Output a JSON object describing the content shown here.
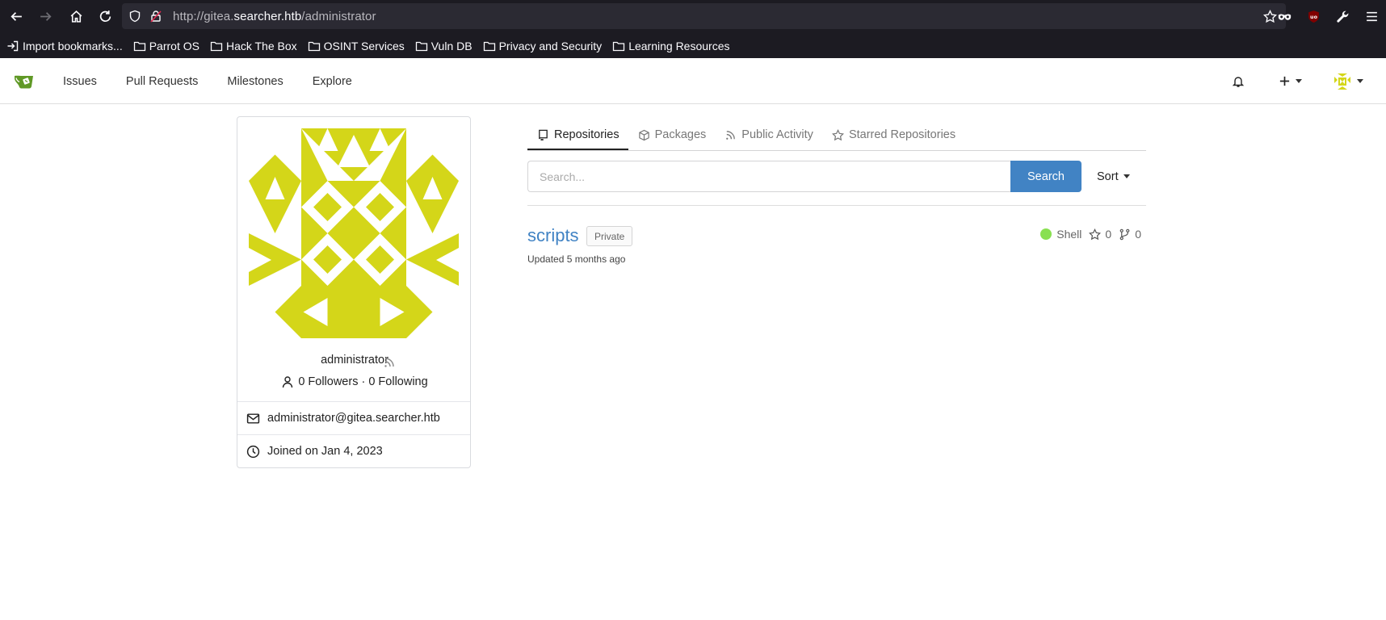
{
  "browser": {
    "url_scheme": "http://gitea.",
    "url_host": "searcher.htb",
    "url_path": "/administrator",
    "bookmarks": [
      {
        "label": "Import bookmarks...",
        "icon": "import-icon"
      },
      {
        "label": "Parrot OS",
        "icon": "folder-icon"
      },
      {
        "label": "Hack The Box",
        "icon": "folder-icon"
      },
      {
        "label": "OSINT Services",
        "icon": "folder-icon"
      },
      {
        "label": "Vuln DB",
        "icon": "folder-icon"
      },
      {
        "label": "Privacy and Security",
        "icon": "folder-icon"
      },
      {
        "label": "Learning Resources",
        "icon": "folder-icon"
      }
    ]
  },
  "header": {
    "nav": [
      "Issues",
      "Pull Requests",
      "Milestones",
      "Explore"
    ]
  },
  "profile": {
    "username": "administrator",
    "followers_text": "0 Followers · 0 Following",
    "email": "administrator@gitea.searcher.htb",
    "joined": "Joined on Jan 4, 2023",
    "avatar_color": "#d4d619"
  },
  "tabs": [
    {
      "label": "Repositories",
      "icon": "repo-icon",
      "active": true
    },
    {
      "label": "Packages",
      "icon": "package-icon",
      "active": false
    },
    {
      "label": "Public Activity",
      "icon": "rss-icon",
      "active": false
    },
    {
      "label": "Starred Repositories",
      "icon": "star-icon",
      "active": false
    }
  ],
  "search": {
    "placeholder": "Search...",
    "button": "Search",
    "sort": "Sort"
  },
  "repos": [
    {
      "name": "scripts",
      "badge": "Private",
      "updated": "Updated 5 months ago",
      "language": "Shell",
      "language_color": "#89e051",
      "stars": "0",
      "forks": "0"
    }
  ],
  "colors": {
    "accent": "#4183c4",
    "chrome_bg": "#1c1b22"
  }
}
